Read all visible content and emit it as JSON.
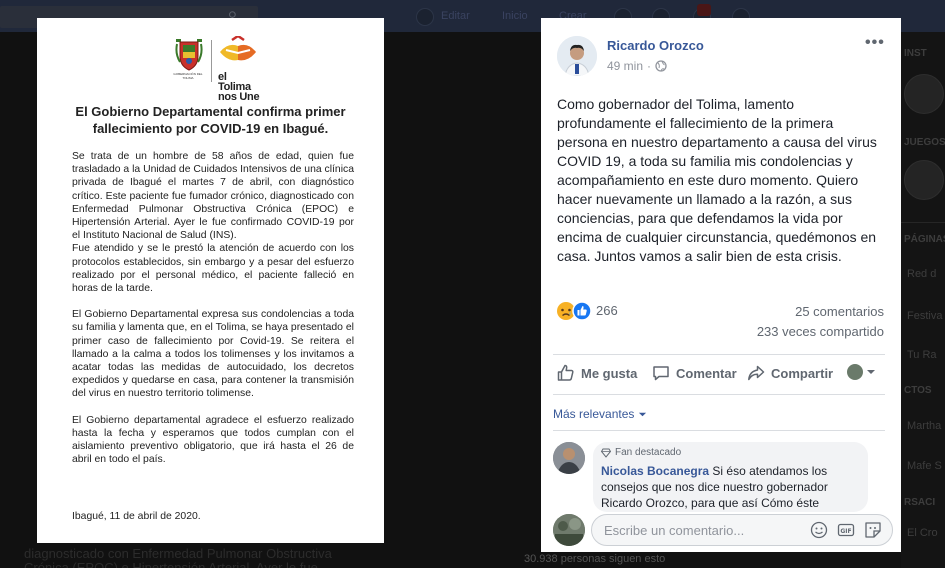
{
  "background": {
    "nav": [
      "Editar",
      "Inicio",
      "Crear"
    ],
    "right_sections": [
      "INST",
      "JUEGOS",
      "PÁGINAS",
      "CTOS",
      "RSACI"
    ],
    "right_items": [
      "Red d",
      "Festiva",
      "Tu Ra",
      "Martha",
      "Mafe S",
      "El Cro"
    ],
    "bottom_text": [
      "diagnosticado con Enfermedad Pulmonar Obstructiva",
      "Crónica (EPOC) e Hipertensión Arterial. Ayer le fue"
    ],
    "followers": "30.938 personas siguen esto"
  },
  "document": {
    "logo_caption": "GOBERNACIÓN DEL TOLIMA",
    "logo_text_1": "el Tolima",
    "logo_text_2": "nos Une",
    "title": "El Gobierno Departamental confirma primer fallecimiento por COVID-19 en Ibagué.",
    "paragraphs": [
      "Se trata de un hombre de 58 años de edad, quien fue trasladado a la Unidad de Cuidados Intensivos de una clínica privada de Ibagué el martes 7 de abril, con diagnóstico crítico. Este paciente fue fumador crónico, diagnosticado con Enfermedad Pulmonar Obstructiva Crónica (EPOC) e Hipertensión Arterial. Ayer le fue confirmado COVID-19 por el Instituto Nacional de Salud (INS).",
      "Fue atendido y se le prestó la atención de acuerdo con los protocolos establecidos, sin embargo y a pesar del esfuerzo realizado por el personal médico, el paciente falleció en horas de la tarde.",
      "El Gobierno Departamental expresa sus condolencias a toda su familia y lamenta que, en el Tolima, se haya presentado el primer caso de fallecimiento por Covid-19. Se reitera el llamado a la calma a todos los tolimenses y los invitamos a acatar todas las medidas de autocuidado, los decretos expedidos y quedarse en casa, para contener la transmisión del virus en nuestro territorio tolimense.",
      "El Gobierno departamental agradece el esfuerzo realizado hasta la fecha y esperamos que todos cumplan con el aislamiento preventivo obligatorio, que irá hasta el 26 de abril en todo el país."
    ],
    "date": "Ibagué, 11 de abril de 2020."
  },
  "post": {
    "author": "Ricardo Orozco",
    "time": "49 min",
    "time_separator": "·",
    "more": "•••",
    "text": "Como gobernador del Tolima, lamento profundamente el fallecimiento de la primera persona en nuestro departamento a causa del virus COVID 19, a toda su familia mis condolencias y acompañamiento en este duro momento. Quiero hacer nuevamente un llamado a la razón, a sus conciencias, para que defendamos la vida por encima de cualquier circunstancia, quedémonos en casa. Juntos vamos a salir bien de esta crisis.",
    "reaction_count": "266",
    "comments": "25 comentarios",
    "shares": "233 veces compartido",
    "actions": {
      "like": "Me gusta",
      "comment": "Comentar",
      "share": "Compartir"
    },
    "sort": "Más relevantes",
    "comment_badge": "Fan destacado",
    "comment_author": "Nicolas Bocanegra",
    "comment_text": "Si éso atendamos los consejos que nos dice nuestro gobernador Ricardo Orozco, para que así Cómo éste",
    "composer_placeholder": "Escribe un comentario...",
    "composer_icons": [
      "emoji-icon",
      "gif-icon",
      "sticker-icon"
    ],
    "colors": {
      "link": "#385898",
      "like_blue": "#1877f2",
      "sad_yellow": "#f7b125"
    }
  }
}
